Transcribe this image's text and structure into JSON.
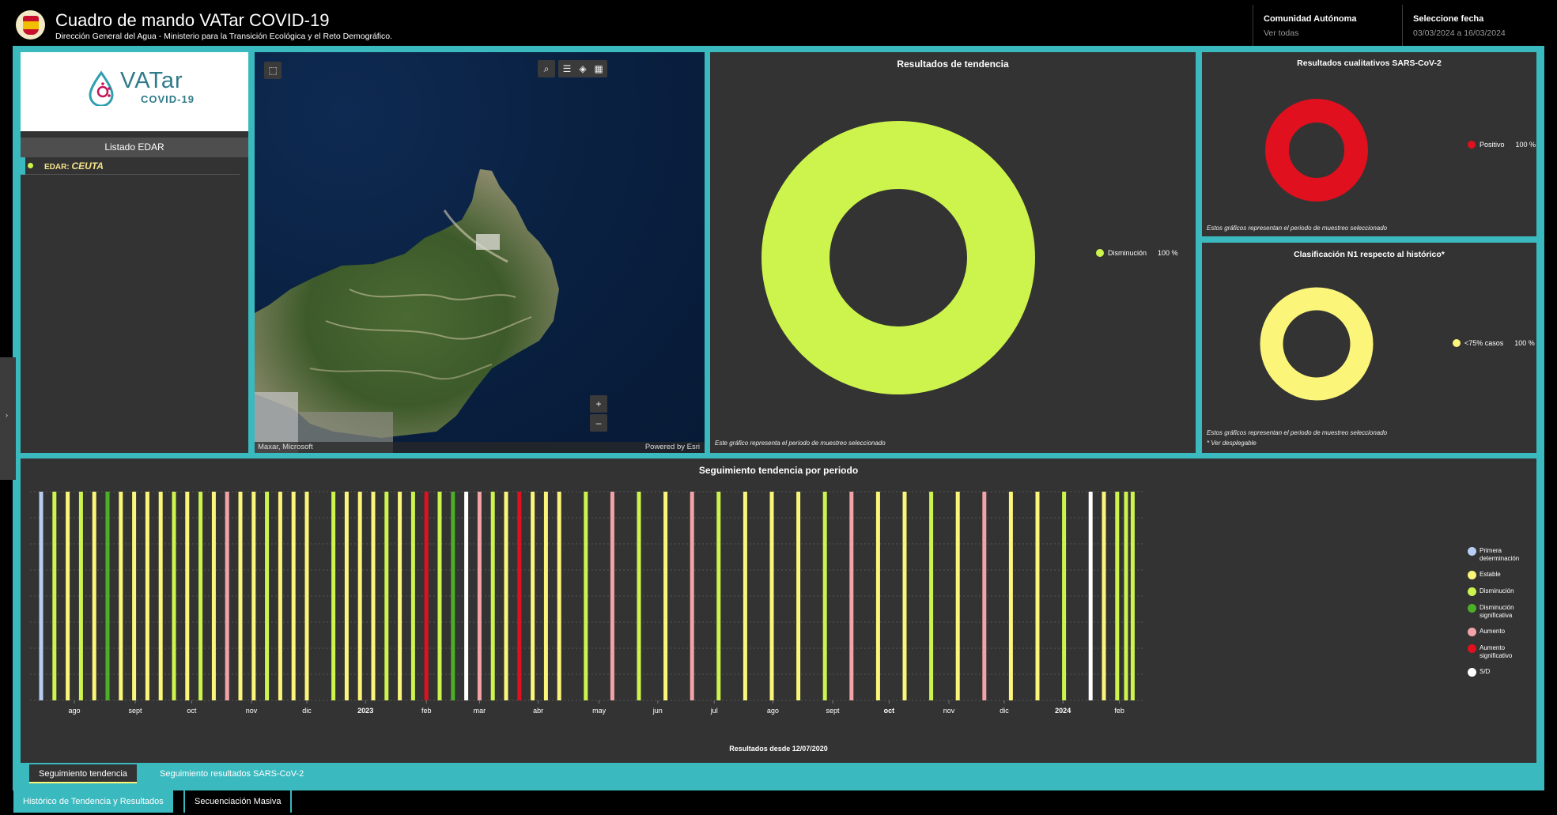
{
  "header": {
    "title": "Cuadro de mando VATar COVID-19",
    "subtitle": "Dirección General del Agua - Ministerio para la Transición Ecológica y el Reto Demográfico.",
    "region_label": "Comunidad Autónoma",
    "region_value": "Ver todas",
    "date_label": "Seleccione fecha",
    "date_value": "03/03/2024 a 16/03/2024"
  },
  "brand": {
    "name": "VATar",
    "sub": "COVID-19"
  },
  "edar_list": {
    "title": "Listado EDAR",
    "items": [
      {
        "prefix": "EDAR:",
        "name": "CEUTA"
      }
    ]
  },
  "map": {
    "credit_left": "Maxar, Microsoft",
    "credit_right": "Powered by Esri",
    "zoom_in": "+",
    "zoom_out": "–",
    "tools": [
      "select-icon",
      "search-icon",
      "list-icon",
      "layers-icon",
      "basemap-icon"
    ]
  },
  "trend_results": {
    "title": "Resultados de tendencia",
    "note": "Este gráfico representa el periodo de muestreo seleccionado",
    "legend": [
      {
        "label": "Disminución",
        "value": "100 %",
        "color": "#cdf44d"
      }
    ]
  },
  "sars_results": {
    "title": "Resultados cualitativos SARS-CoV-2",
    "note": "Estos gráficos representan el periodo de muestreo seleccionado",
    "legend": [
      {
        "label": "Positivo",
        "value": "100 %",
        "color": "#e0101e"
      }
    ]
  },
  "n1_results": {
    "title": "Clasificación N1 respecto al histórico*",
    "note": "Estos gráficos representan el periodo de muestreo seleccionado",
    "note2": "* Ver desplegable",
    "legend": [
      {
        "label": "<75% casos",
        "value": "100 %",
        "color": "#fbf57a"
      }
    ]
  },
  "colors": {
    "accent": "#3ab9bf",
    "panel": "#333333",
    "primera": "#b7cdf2",
    "estable": "#fbf57a",
    "disminucion": "#cdf44d",
    "dism_sig": "#4caf28",
    "aumento": "#f2a3a8",
    "aumento_sig": "#e0101e",
    "sd": "#ffffff"
  },
  "chart_data": {
    "type": "bar",
    "title": "Seguimiento tendencia por periodo",
    "xlabel": "Resultados desde 12/07/2020",
    "x_ticks": [
      "ago",
      "sept",
      "oct",
      "nov",
      "dic",
      "2023",
      "feb",
      "mar",
      "abr",
      "may",
      "jun",
      "jul",
      "ago",
      "sept",
      "oct",
      "nov",
      "dic",
      "2024",
      "feb"
    ],
    "x_ticks_bold": [
      "2023",
      "oct",
      "2024"
    ],
    "legend": [
      {
        "key": "P",
        "label": "Primera determinación",
        "color": "#b7cdf2"
      },
      {
        "key": "E",
        "label": "Estable",
        "color": "#fbf57a"
      },
      {
        "key": "D",
        "label": "Disminución",
        "color": "#cdf44d"
      },
      {
        "key": "DS",
        "label": "Disminución significativa",
        "color": "#4caf28"
      },
      {
        "key": "A",
        "label": "Aumento",
        "color": "#f2a3a8"
      },
      {
        "key": "AS",
        "label": "Aumento significativo",
        "color": "#e0101e"
      },
      {
        "key": "SD",
        "label": "S/D",
        "color": "#ffffff"
      }
    ],
    "bars": [
      "P",
      "D",
      "E",
      "D",
      "E",
      "DS",
      "E",
      "E",
      "E",
      "E",
      "D",
      "E",
      "D",
      "E",
      "A",
      "E",
      "E",
      "D",
      "E",
      "E",
      "E",
      "D",
      "E",
      "E",
      "E",
      "D",
      "E",
      "D",
      "AS",
      "D",
      "DS",
      "SD",
      "A",
      "D",
      "E",
      "AS",
      "E",
      "E",
      "E",
      "D",
      "A",
      "D",
      "E",
      "A",
      "D",
      "E",
      "E",
      "E",
      "D",
      "A",
      "E",
      "E",
      "D",
      "E",
      "A",
      "E",
      "E",
      "D",
      "SD",
      "E",
      "D",
      "D",
      "D"
    ],
    "bar_positions_pct": [
      1.0,
      2.2,
      3.4,
      4.6,
      5.8,
      7.0,
      8.2,
      9.4,
      10.6,
      11.8,
      13.0,
      14.2,
      15.4,
      16.6,
      17.8,
      19.0,
      20.2,
      21.4,
      22.6,
      23.8,
      25.0,
      27.4,
      28.6,
      29.8,
      31.0,
      32.2,
      33.4,
      34.6,
      35.8,
      37.0,
      38.2,
      39.4,
      40.6,
      41.8,
      43.0,
      44.2,
      45.4,
      46.6,
      47.8,
      50.2,
      52.6,
      55.0,
      57.4,
      59.8,
      62.2,
      64.6,
      67.0,
      69.4,
      71.8,
      74.2,
      76.6,
      79.0,
      81.4,
      83.8,
      86.2,
      88.6,
      91.0,
      93.4,
      95.8,
      97.0,
      98.2,
      99.0,
      99.6
    ],
    "tick_positions_pct": [
      4,
      9.5,
      14.6,
      20,
      25,
      30.3,
      35.8,
      40.6,
      45.9,
      51.4,
      56.7,
      61.8,
      67.1,
      72.5,
      77.6,
      83,
      88,
      93.3,
      98.4
    ]
  },
  "chart_tabs": [
    "Seguimiento tendencia",
    "Seguimiento resultados SARS-CoV-2"
  ],
  "main_tabs": [
    "Histórico de Tendencia y Resultados",
    "Secuenciación Masiva"
  ]
}
